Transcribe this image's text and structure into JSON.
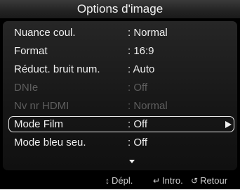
{
  "title": "Options d'image",
  "rows": [
    {
      "label": "Nuance coul.",
      "value": ": Normal"
    },
    {
      "label": "Format",
      "value": ": 16:9"
    },
    {
      "label": "Réduct. bruit num.",
      "value": ": Auto"
    },
    {
      "label": "DNIe",
      "value": ": Off"
    },
    {
      "label": "Nv nr HDMI",
      "value": ": Normal"
    },
    {
      "label": "Mode Film",
      "value": ": Off"
    },
    {
      "label": "Mode bleu seu.",
      "value": ": Off"
    }
  ],
  "footer": {
    "move_icon": "↕",
    "move_label": "Dépl.",
    "enter_icon": "↵",
    "enter_label": "Intro.",
    "return_icon": "↺",
    "return_label": "Retour"
  }
}
